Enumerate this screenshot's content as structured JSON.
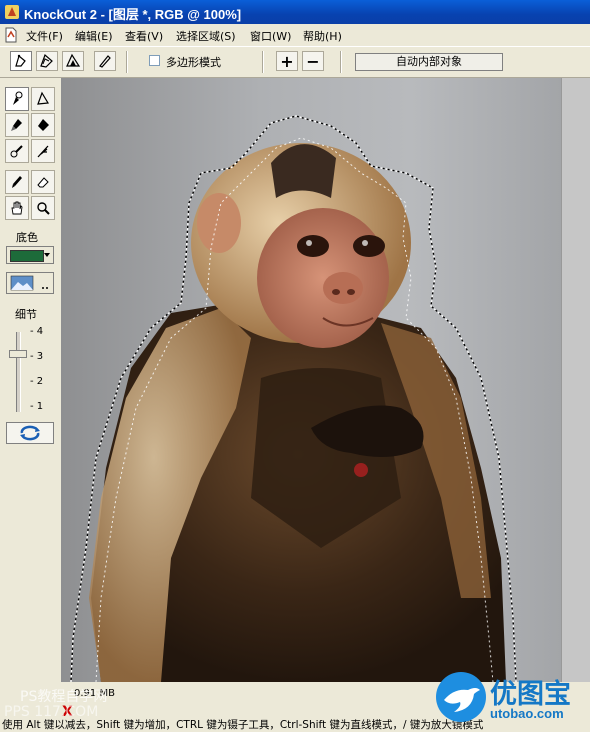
{
  "window": {
    "title": "KnockOut 2 - [图层 *, RGB @ 100%]"
  },
  "menu": [
    "文件(F)",
    "编辑(E)",
    "查看(V)",
    "选择区域(S)",
    "窗口(W)",
    "帮助(H)"
  ],
  "toolbar": {
    "polygon_mode_label": "多边形模式",
    "polygon_mode_checked": false,
    "add_label": "+",
    "subtract_label": "−",
    "auto_inside_object_label": "自动内部对象"
  },
  "left_panel": {
    "background_color_label": "底色",
    "background_color": "#1d6b3a",
    "detail_label": "细节",
    "detail_value": 3,
    "detail_ticks": [
      "4",
      "3",
      "2",
      "1"
    ]
  },
  "status": {
    "memory": "0.91 MB",
    "hint": "使用 Alt 键以减去，Shift 键为增加，CTRL 键为镊子工具，Ctrl-Shift 键为直线模式，/ 键为放大镜模式"
  },
  "watermarks": {
    "left_line1": "PS教程自学网",
    "left_line2": "PPS 117.COM",
    "logo_text": "优图宝",
    "logo_url": "utobao.com"
  }
}
